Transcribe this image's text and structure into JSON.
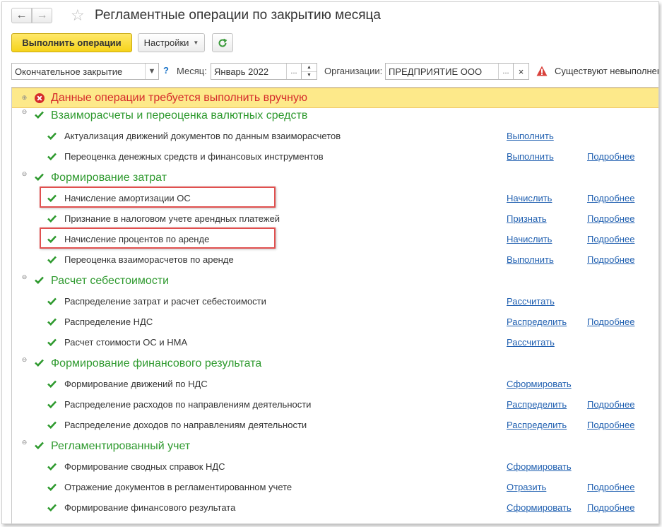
{
  "window": {
    "title": "Регламентные операции по закрытию месяца"
  },
  "toolbar": {
    "run_label": "Выполнить операции",
    "settings_label": "Настройки"
  },
  "filters": {
    "mode_value": "Окончательное закрытие",
    "help_glyph": "?",
    "month_label": "Месяц:",
    "month_value": "Январь 2022",
    "org_label": "Организации:",
    "org_value": "ПРЕДПРИЯТИЕ ООО",
    "ellipsis": "...",
    "clear": "×",
    "warning_text": "Существуют невыполнен"
  },
  "list": {
    "alert_group": {
      "label": "Данные операции требуется выполнить вручную",
      "icon": "error-circle-icon"
    },
    "groups": [
      {
        "label": "Взаиморасчеты и переоценка валютных средств",
        "items": [
          {
            "label": "Актуализация движений документов по данным взаиморасчетов",
            "action": "Выполнить",
            "more": ""
          },
          {
            "label": "Переоценка денежных средств и финансовых инструментов",
            "action": "Выполнить",
            "more": "Подробнее"
          }
        ]
      },
      {
        "label": "Формирование затрат",
        "items": [
          {
            "label": "Начисление амортизации ОС",
            "action": "Начислить",
            "more": "Подробнее"
          },
          {
            "label": "Признание в налоговом учете арендных платежей",
            "action": "Признать",
            "more": "Подробнее"
          },
          {
            "label": "Начисление процентов по аренде",
            "action": "Начислить",
            "more": "Подробнее"
          },
          {
            "label": "Переоценка взаиморасчетов по аренде",
            "action": "Выполнить",
            "more": "Подробнее"
          }
        ]
      },
      {
        "label": "Расчет себестоимости",
        "items": [
          {
            "label": "Распределение затрат и расчет себестоимости",
            "action": "Рассчитать",
            "more": ""
          },
          {
            "label": "Распределение НДС",
            "action": "Распределить",
            "more": "Подробнее"
          },
          {
            "label": "Расчет стоимости ОС и НМА",
            "action": "Рассчитать",
            "more": ""
          }
        ]
      },
      {
        "label": "Формирование финансового результата",
        "items": [
          {
            "label": "Формирование движений по НДС",
            "action": "Сформировать",
            "more": ""
          },
          {
            "label": "Распределение расходов по направлениям деятельности",
            "action": "Распределить",
            "more": "Подробнее"
          },
          {
            "label": "Распределение доходов по направлениям деятельности",
            "action": "Распределить",
            "more": "Подробнее"
          }
        ]
      },
      {
        "label": "Регламентированный учет",
        "items": [
          {
            "label": "Формирование сводных справок НДС",
            "action": "Сформировать",
            "more": ""
          },
          {
            "label": "Отражение документов в регламентированном учете",
            "action": "Отразить",
            "more": "Подробнее"
          },
          {
            "label": "Формирование финансового результата",
            "action": "Сформировать",
            "more": "Подробнее"
          }
        ]
      }
    ]
  },
  "colors": {
    "group_green": "#2f9a2f",
    "alert_red": "#d52b2b",
    "alert_bg": "#fde98a",
    "link_blue": "#1f5fb0",
    "highlight_red": "#e0504f"
  }
}
